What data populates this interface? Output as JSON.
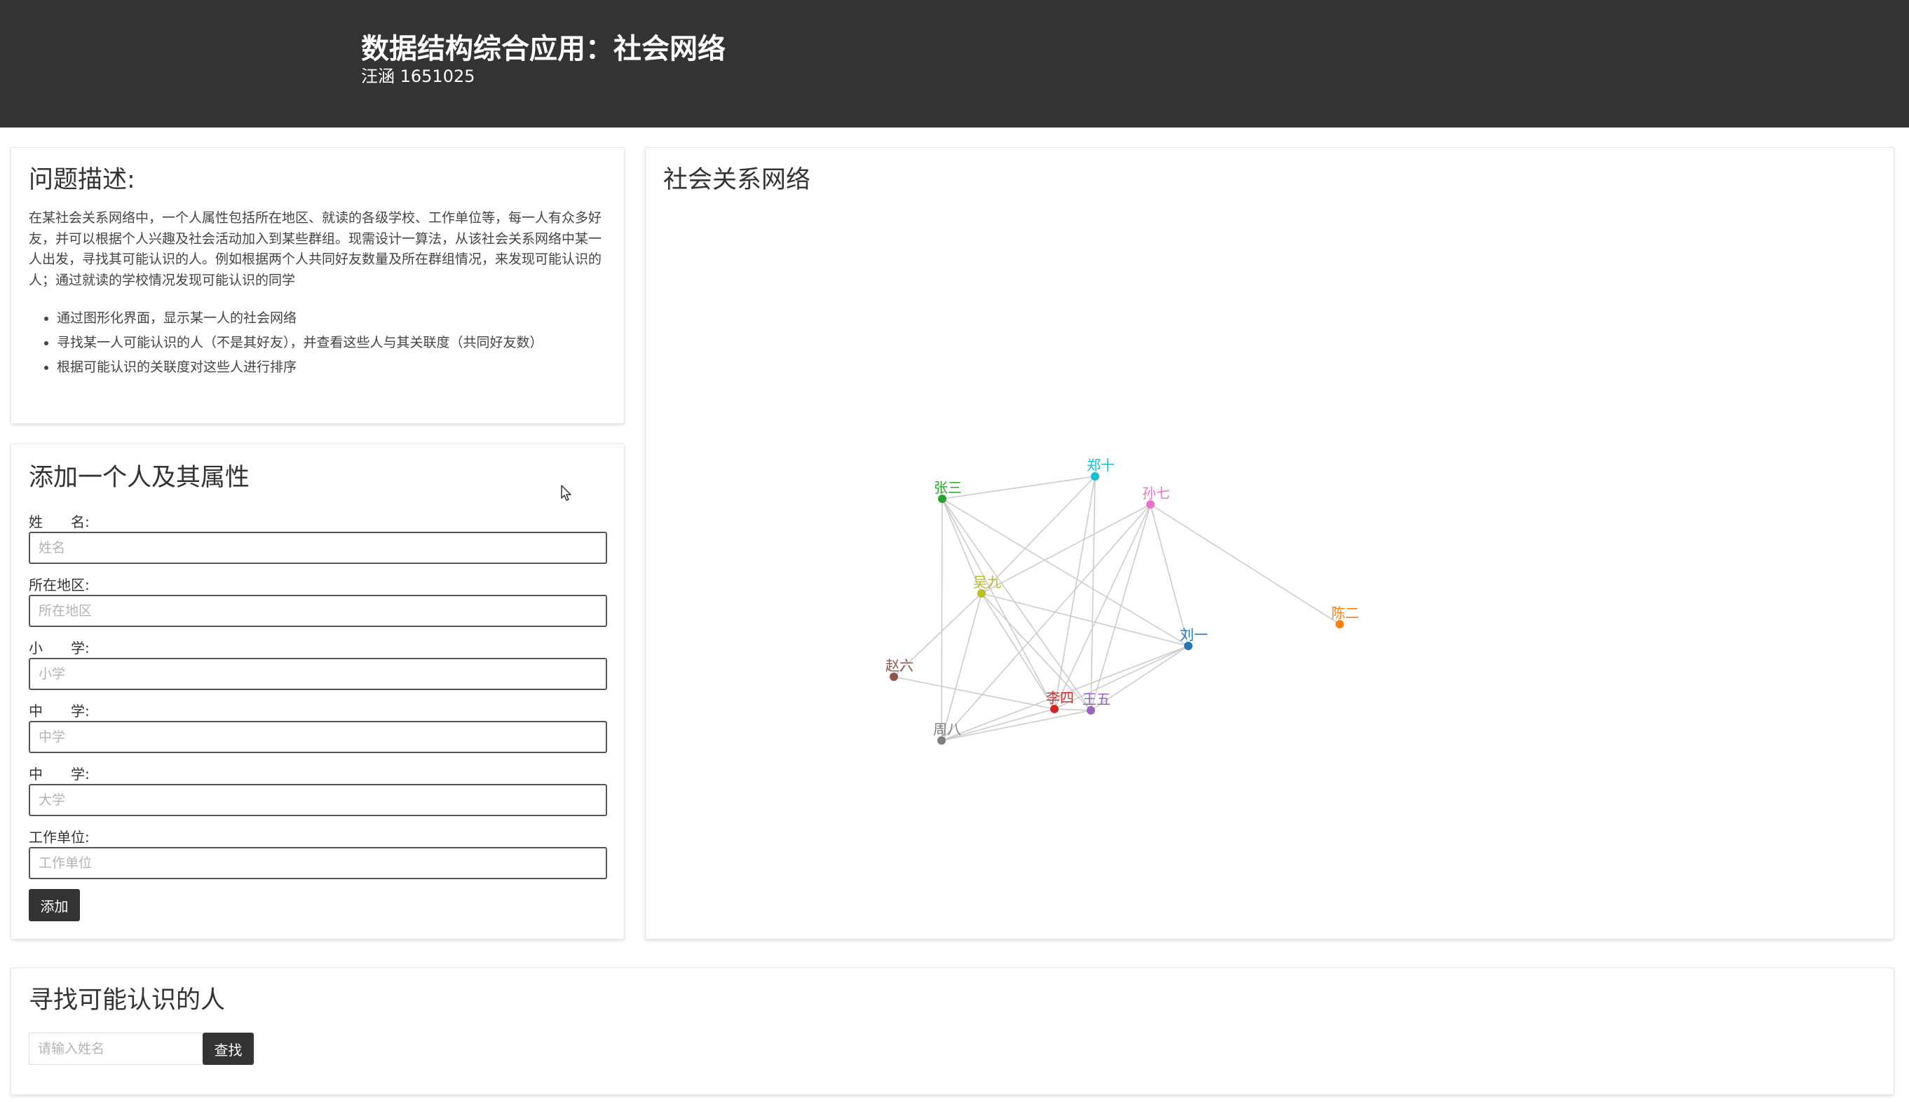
{
  "header": {
    "title": "数据结构综合应用：社会网络",
    "subtitle": "汪涵 1651025"
  },
  "description": {
    "heading": "问题描述:",
    "text": "在某社会关系网络中，一个人属性包括所在地区、就读的各级学校、工作单位等，每一人有众多好友，并可以根据个人兴趣及社会活动加入到某些群组。现需设计一算法，从该社会关系网络中某一人出发，寻找其可能认识的人。例如根据两个人共同好友数量及所在群组情况，来发现可能认识的人；通过就读的学校情况发现可能认识的同学",
    "bullets": [
      "通过图形化界面，显示某一人的社会网络",
      "寻找某一人可能认识的人（不是其好友），并查看这些人与其关联度（共同好友数）",
      "根据可能认识的关联度对这些人进行排序"
    ]
  },
  "add_form": {
    "heading": "添加一个人及其属性",
    "fields": [
      {
        "label": "姓　　名:",
        "placeholder": "姓名",
        "value": ""
      },
      {
        "label": "所在地区:",
        "placeholder": "所在地区",
        "value": ""
      },
      {
        "label": "小　　学:",
        "placeholder": "小学",
        "value": ""
      },
      {
        "label": "中　　学:",
        "placeholder": "中学",
        "value": ""
      },
      {
        "label": "中　　学:",
        "placeholder": "大学",
        "value": ""
      },
      {
        "label": "工作单位:",
        "placeholder": "工作单位",
        "value": ""
      }
    ],
    "submit_label": "添加"
  },
  "network": {
    "heading": "社会关系网络",
    "edge_color": "#cccccc",
    "nodes": [
      {
        "id": "zhangsan",
        "label": "张三",
        "color": "#2ca02c"
      },
      {
        "id": "zhengshi",
        "label": "郑十",
        "color": "#17becf"
      },
      {
        "id": "sunqi",
        "label": "孙七",
        "color": "#e377c2"
      },
      {
        "id": "wujiu",
        "label": "吴九",
        "color": "#bcbd22"
      },
      {
        "id": "liuyi",
        "label": "刘一",
        "color": "#1f77b4"
      },
      {
        "id": "chener",
        "label": "陈二",
        "color": "#ff7f0e"
      },
      {
        "id": "zhaoliu",
        "label": "赵六",
        "color": "#8c564b"
      },
      {
        "id": "lisi",
        "label": "李四",
        "color": "#d62728"
      },
      {
        "id": "wangwu",
        "label": "王五",
        "color": "#9467bd"
      },
      {
        "id": "zhouba",
        "label": "周八",
        "color": "#7f7f7f"
      }
    ],
    "edges": [
      [
        "zhangsan",
        "zhengshi"
      ],
      [
        "zhangsan",
        "wujiu"
      ],
      [
        "zhangsan",
        "liuyi"
      ],
      [
        "zhangsan",
        "lisi"
      ],
      [
        "zhangsan",
        "wangwu"
      ],
      [
        "zhangsan",
        "zhouba"
      ],
      [
        "zhengshi",
        "wujiu"
      ],
      [
        "zhengshi",
        "lisi"
      ],
      [
        "zhengshi",
        "wangwu"
      ],
      [
        "sunqi",
        "liuyi"
      ],
      [
        "sunqi",
        "chener"
      ],
      [
        "sunqi",
        "lisi"
      ],
      [
        "sunqi",
        "wangwu"
      ],
      [
        "sunqi",
        "zhouba"
      ],
      [
        "sunqi",
        "wujiu"
      ],
      [
        "wujiu",
        "zhaoliu"
      ],
      [
        "wujiu",
        "liuyi"
      ],
      [
        "wujiu",
        "lisi"
      ],
      [
        "wujiu",
        "wangwu"
      ],
      [
        "wujiu",
        "zhouba"
      ],
      [
        "liuyi",
        "lisi"
      ],
      [
        "liuyi",
        "wangwu"
      ],
      [
        "liuyi",
        "zhouba"
      ],
      [
        "zhaoliu",
        "lisi"
      ],
      [
        "lisi",
        "wangwu"
      ],
      [
        "lisi",
        "zhouba"
      ],
      [
        "wangwu",
        "zhouba"
      ]
    ]
  },
  "search": {
    "heading": "寻找可能认识的人",
    "placeholder": "请输入姓名",
    "button_label": "查找"
  }
}
